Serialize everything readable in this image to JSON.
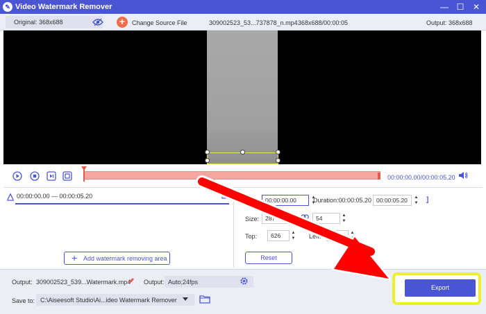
{
  "app": {
    "title": "Video Watermark Remover"
  },
  "window": {
    "minimize": "—",
    "maximize": "☐",
    "close": "✕"
  },
  "info": {
    "original": "Original: 368x688",
    "change_source": "Change Source File",
    "filename": "309002523_53...737878_n.mp4",
    "fileinfo": "368x688/00:00:05",
    "output": "Output: 368x688"
  },
  "timeline": {
    "current_total": "00:00:00.00/00:00:05.20"
  },
  "segment": {
    "range": "00:00:00.00 — 00:00:05.20"
  },
  "left": {
    "add_area": "Add watermark removing area"
  },
  "right": {
    "open_bracket": "[",
    "close_bracket": "]",
    "start_time": "00:00:00.00",
    "duration_label": "Duration:00:00:05.20",
    "end_time": "00:00:05.20",
    "size_label": "Size:",
    "width": "287",
    "height": "54",
    "top_label": "Top:",
    "top": "626",
    "left_label": "Left:",
    "left": "0",
    "reset": "Reset"
  },
  "bottom": {
    "output_label": "Output:",
    "output_file": "309002523_539...Watermark.mp4",
    "format_label": "Output:",
    "format": "Auto;24fps",
    "save_label": "Save to:",
    "save_path": "C:\\Aiseesoft Studio\\Ai...ideo Watermark Remover",
    "export": "Export"
  },
  "colors": {
    "accent": "#4a55d4",
    "timeline": "#f4a6a0",
    "highlight": "#ecf02a",
    "arrow": "#ff0000"
  },
  "icons": [
    "app-logo-icon",
    "eye-icon",
    "plus-icon",
    "play-icon",
    "stop-icon",
    "next-frame-icon",
    "crop-icon",
    "volume-icon",
    "segment-icon",
    "cut-icon",
    "link-icon",
    "pencil-icon",
    "gear-icon",
    "folder-icon",
    "chevron-down-icon"
  ]
}
